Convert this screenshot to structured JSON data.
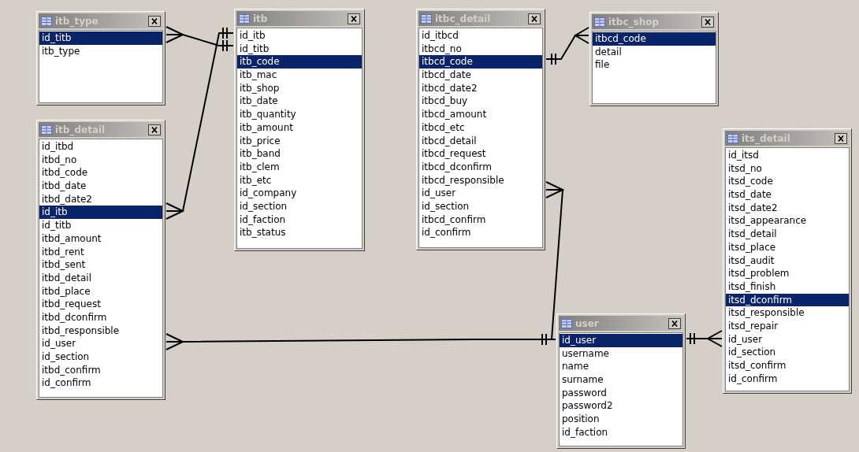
{
  "tables": [
    {
      "name": "itb_type",
      "fields": [
        {
          "name": "id_titb",
          "selected": true
        },
        {
          "name": "itb_type",
          "selected": false
        }
      ]
    },
    {
      "name": "itb",
      "fields": [
        {
          "name": "id_itb",
          "selected": false
        },
        {
          "name": "id_titb",
          "selected": false
        },
        {
          "name": "itb_code",
          "selected": true
        },
        {
          "name": "itb_mac",
          "selected": false
        },
        {
          "name": "itb_shop",
          "selected": false
        },
        {
          "name": "itb_date",
          "selected": false
        },
        {
          "name": "itb_quantity",
          "selected": false
        },
        {
          "name": "itb_amount",
          "selected": false
        },
        {
          "name": "itb_price",
          "selected": false
        },
        {
          "name": "itb_band",
          "selected": false
        },
        {
          "name": "itb_clem",
          "selected": false
        },
        {
          "name": "itb_etc",
          "selected": false
        },
        {
          "name": "id_company",
          "selected": false
        },
        {
          "name": "id_section",
          "selected": false
        },
        {
          "name": "id_faction",
          "selected": false
        },
        {
          "name": "itb_status",
          "selected": false
        }
      ]
    },
    {
      "name": "itbc_detail",
      "fields": [
        {
          "name": "id_itbcd",
          "selected": false
        },
        {
          "name": "itbcd_no",
          "selected": false
        },
        {
          "name": "itbcd_code",
          "selected": true
        },
        {
          "name": "itbcd_date",
          "selected": false
        },
        {
          "name": "itbcd_date2",
          "selected": false
        },
        {
          "name": "itbcd_buy",
          "selected": false
        },
        {
          "name": "itbcd_amount",
          "selected": false
        },
        {
          "name": "itbcd_etc",
          "selected": false
        },
        {
          "name": "itbcd_detail",
          "selected": false
        },
        {
          "name": "itbcd_request",
          "selected": false
        },
        {
          "name": "itbcd_dconfirm",
          "selected": false
        },
        {
          "name": "itbcd_responsible",
          "selected": false
        },
        {
          "name": "id_user",
          "selected": false
        },
        {
          "name": "id_section",
          "selected": false
        },
        {
          "name": "itbcd_confirm",
          "selected": false
        },
        {
          "name": "id_confirm",
          "selected": false
        }
      ]
    },
    {
      "name": "itbc_shop",
      "fields": [
        {
          "name": "itbcd_code",
          "selected": true
        },
        {
          "name": "detail",
          "selected": false
        },
        {
          "name": "file",
          "selected": false
        }
      ]
    },
    {
      "name": "itb_detail",
      "fields": [
        {
          "name": "id_itbd",
          "selected": false
        },
        {
          "name": "itbd_no",
          "selected": false
        },
        {
          "name": "itbd_code",
          "selected": false
        },
        {
          "name": "itbd_date",
          "selected": false
        },
        {
          "name": "itbd_date2",
          "selected": false
        },
        {
          "name": "id_itb",
          "selected": true
        },
        {
          "name": "id_titb",
          "selected": false
        },
        {
          "name": "itbd_amount",
          "selected": false
        },
        {
          "name": "itbd_rent",
          "selected": false
        },
        {
          "name": "itbd_sent",
          "selected": false
        },
        {
          "name": "itbd_detail",
          "selected": false
        },
        {
          "name": "itbd_place",
          "selected": false
        },
        {
          "name": "itbd_request",
          "selected": false
        },
        {
          "name": "itbd_dconfirm",
          "selected": false
        },
        {
          "name": "itbd_responsible",
          "selected": false
        },
        {
          "name": "id_user",
          "selected": false
        },
        {
          "name": "id_section",
          "selected": false
        },
        {
          "name": "itbd_confirm",
          "selected": false
        },
        {
          "name": "id_confirm",
          "selected": false
        }
      ]
    },
    {
      "name": "its_detail",
      "fields": [
        {
          "name": "id_itsd",
          "selected": false
        },
        {
          "name": "itsd_no",
          "selected": false
        },
        {
          "name": "itsd_code",
          "selected": false
        },
        {
          "name": "itsd_date",
          "selected": false
        },
        {
          "name": "itsd_date2",
          "selected": false
        },
        {
          "name": "itsd_appearance",
          "selected": false
        },
        {
          "name": "itsd_detail",
          "selected": false
        },
        {
          "name": "itsd_place",
          "selected": false
        },
        {
          "name": "itsd_audit",
          "selected": false
        },
        {
          "name": "itsd_problem",
          "selected": false
        },
        {
          "name": "itsd_finish",
          "selected": false
        },
        {
          "name": "itsd_dconfirm",
          "selected": true
        },
        {
          "name": "itsd_responsible",
          "selected": false
        },
        {
          "name": "itsd_repair",
          "selected": false
        },
        {
          "name": "id_user",
          "selected": false
        },
        {
          "name": "id_section",
          "selected": false
        },
        {
          "name": "itsd_confirm",
          "selected": false
        },
        {
          "name": "id_confirm",
          "selected": false
        }
      ]
    },
    {
      "name": "user",
      "fields": [
        {
          "name": "id_user",
          "selected": true
        },
        {
          "name": "username",
          "selected": false
        },
        {
          "name": "name",
          "selected": false
        },
        {
          "name": "surname",
          "selected": false
        },
        {
          "name": "password",
          "selected": false
        },
        {
          "name": "password2",
          "selected": false
        },
        {
          "name": "position",
          "selected": false
        },
        {
          "name": "id_faction",
          "selected": false
        }
      ]
    }
  ]
}
